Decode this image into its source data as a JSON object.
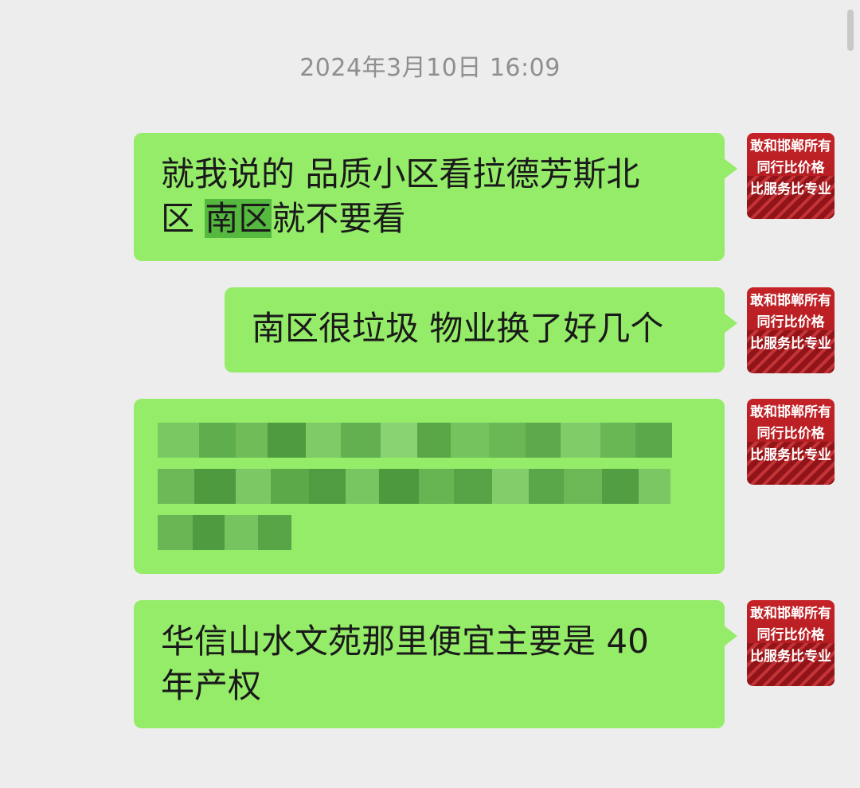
{
  "timestamp": "2024年3月10日 16:09",
  "avatar": {
    "lines": [
      "敢和邯郸所有",
      "同行比价格",
      "比服务比专业"
    ]
  },
  "messages": [
    {
      "line1": "就我说的 品质小区看拉德芳斯北",
      "line2_prefix": "区 ",
      "line2_highlight": "南区",
      "line2_suffix": "就不要看"
    },
    {
      "text": "南区很垃圾 物业换了好几个"
    },
    {
      "obscured": true
    },
    {
      "line1": "华信山水文苑那里便宜主要是 40",
      "line2": "年产权"
    }
  ],
  "colors": {
    "background": "#ededed",
    "bubble": "#95ec69",
    "highlight": "#55b83f",
    "avatar": "#c42327",
    "timestamp": "#8f8f8f"
  },
  "icons": {
    "avatar": "red-billboard-avatar"
  }
}
